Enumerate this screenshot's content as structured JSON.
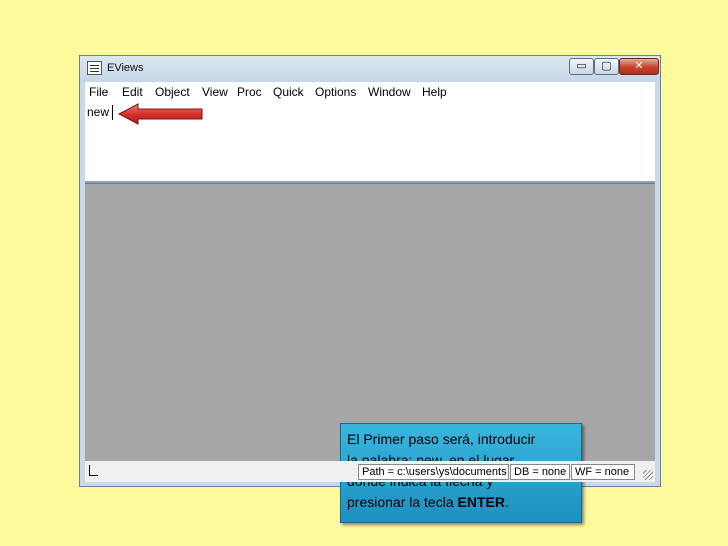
{
  "window": {
    "title": "EViews",
    "controls": {
      "minimize": "▭",
      "maximize": "▢",
      "close": "✕"
    }
  },
  "menu": [
    "File",
    "Edit",
    "Object",
    "View",
    "Proc",
    "Quick",
    "Options",
    "Window",
    "Help"
  ],
  "command": {
    "value": "new"
  },
  "callout": {
    "line1": "El Primer paso será, introducir",
    "line2": "la palabra: new, en el lugar",
    "line3": "donde indica la flecha y",
    "line4_prefix": "presionar la tecla ",
    "line4_bold": "ENTER",
    "line4_suffix": "."
  },
  "status": {
    "path": "Path = c:\\users\\ys\\documents",
    "db": "DB = none",
    "wf": "WF = none"
  },
  "colors": {
    "page_background": "#fdfa9c",
    "arrow": "#d8302b",
    "callout": "#2aa5d6",
    "workspace": "#a7a7a7"
  },
  "icons": [
    "eviews-app-icon",
    "minimize-icon",
    "maximize-icon",
    "close-icon",
    "red-arrow-icon",
    "resize-grip-icon"
  ]
}
